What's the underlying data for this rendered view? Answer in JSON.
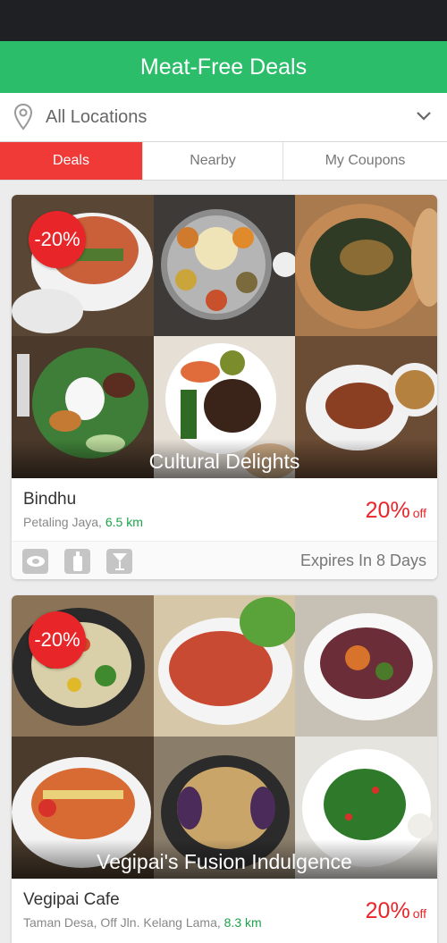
{
  "header": {
    "title": "Meat-Free Deals"
  },
  "location": {
    "label": "All Locations",
    "pin_icon": "map-pin-icon",
    "dropdown_icon": "chevron-down-icon"
  },
  "tabs": [
    {
      "label": "Deals",
      "active": true
    },
    {
      "label": "Nearby",
      "active": false
    },
    {
      "label": "My Coupons",
      "active": false
    }
  ],
  "deals": [
    {
      "badge": "-20%",
      "caption": "Cultural Delights",
      "name": "Bindhu",
      "area": "Petaling Jaya, ",
      "distance": "6.5 km",
      "discount": "20%",
      "discount_suffix": "off",
      "amenity_icons": [
        "view-icon",
        "bottle-icon",
        "cocktail-icon"
      ],
      "expires": "Expires In 8 Days"
    },
    {
      "badge": "-20%",
      "caption": "Vegipai's Fusion Indulgence",
      "name": "Vegipai Cafe",
      "area": "Taman Desa, Off Jln. Kelang Lama, ",
      "distance": "8.3 km",
      "discount": "20%",
      "discount_suffix": "off"
    }
  ],
  "colors": {
    "header_green": "#2bbd6a",
    "active_tab_red": "#ef3a38",
    "discount_red": "#e8262a",
    "distance_green": "#1aa34a"
  }
}
